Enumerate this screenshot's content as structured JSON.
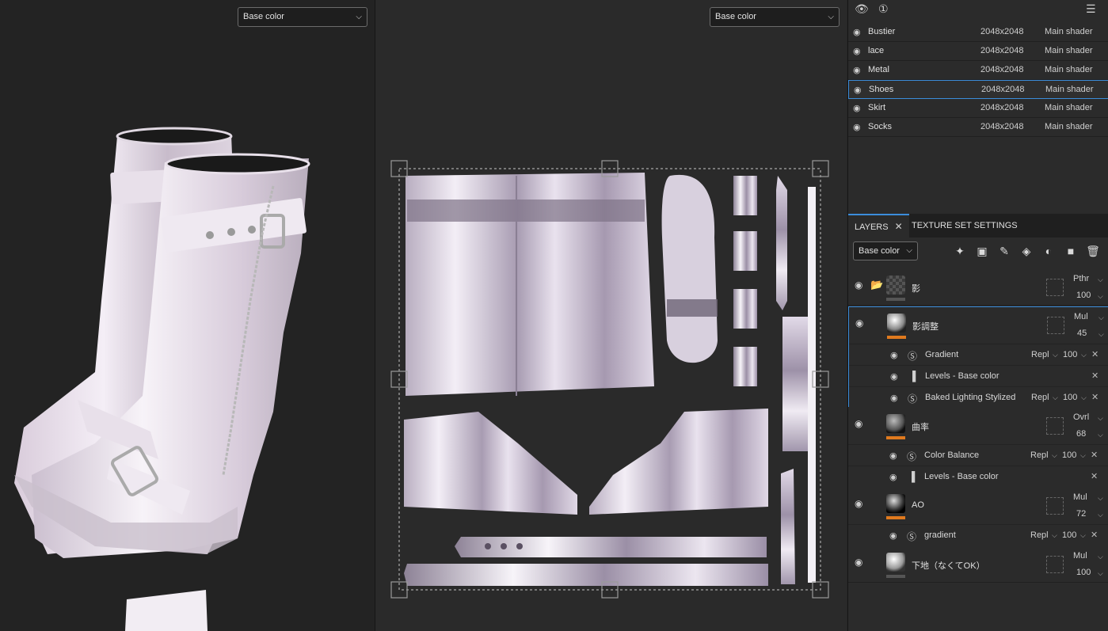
{
  "viewport3d": {
    "channel_dropdown": "Base color"
  },
  "viewport2d": {
    "channel_dropdown": "Base color"
  },
  "texture_sets": [
    {
      "name": "Bustier",
      "resolution": "2048x2048",
      "shader": "Main shader"
    },
    {
      "name": "lace",
      "resolution": "2048x2048",
      "shader": "Main shader"
    },
    {
      "name": "Metal",
      "resolution": "2048x2048",
      "shader": "Main shader"
    },
    {
      "name": "Shoes",
      "resolution": "2048x2048",
      "shader": "Main shader",
      "selected": true
    },
    {
      "name": "Skirt",
      "resolution": "2048x2048",
      "shader": "Main shader"
    },
    {
      "name": "Socks",
      "resolution": "2048x2048",
      "shader": "Main shader"
    }
  ],
  "tabs": {
    "layers": "LAYERS",
    "texture_set_settings": "TEXTURE SET SETTINGS"
  },
  "layers_toolbar": {
    "channel_dropdown": "Base color"
  },
  "layers": [
    {
      "name": "影",
      "blend": "Pthr",
      "opacity": "100",
      "type": "folder"
    },
    {
      "name": "影調整",
      "blend": "Mul",
      "opacity": "45",
      "type": "fill",
      "effects": [
        {
          "name": "Gradient",
          "blend": "Repl",
          "opacity": "100"
        },
        {
          "name": "Levels - Base color"
        },
        {
          "name": "Baked Lighting Stylized",
          "blend": "Repl",
          "opacity": "100"
        }
      ]
    },
    {
      "name": "曲率",
      "blend": "Ovrl",
      "opacity": "68",
      "type": "fill",
      "effects": [
        {
          "name": "Color Balance",
          "blend": "Repl",
          "opacity": "100"
        },
        {
          "name": "Levels - Base color"
        }
      ]
    },
    {
      "name": "AO",
      "blend": "Mul",
      "opacity": "72",
      "type": "fill",
      "effects": [
        {
          "name": "gradient",
          "blend": "Repl",
          "opacity": "100"
        }
      ]
    },
    {
      "name": "下地（なくてOK）",
      "blend": "Mul",
      "opacity": "100",
      "type": "fill"
    }
  ],
  "colors": {
    "accent": "#3b8ddb",
    "mask_bar": "#e07a1e",
    "panel": "#2b2b2b",
    "viewport": "#262626"
  }
}
